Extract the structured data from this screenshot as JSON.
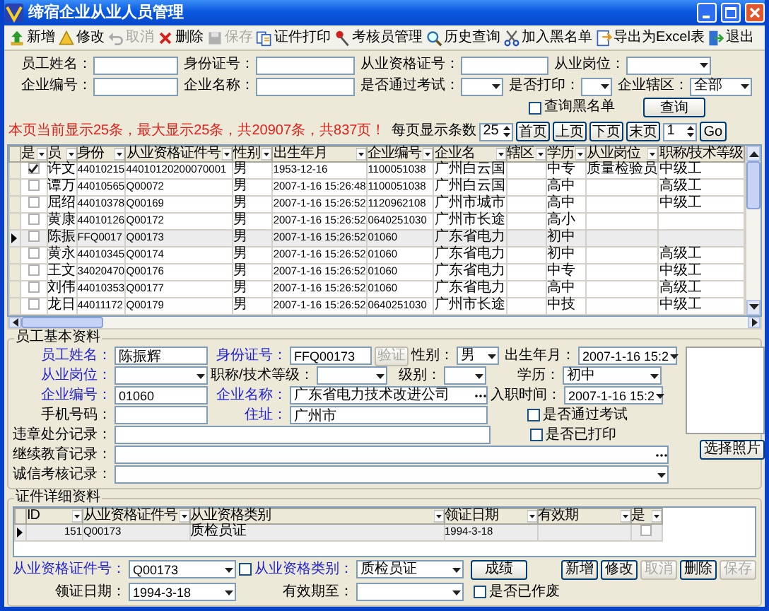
{
  "window": {
    "title": "缔宿企业从业人员管理"
  },
  "toolbar": [
    {
      "label": "新增",
      "kind": "add",
      "disabled": false
    },
    {
      "label": "修改",
      "kind": "edit",
      "disabled": false
    },
    {
      "label": "取消",
      "kind": "cancel",
      "disabled": true
    },
    {
      "label": "删除",
      "kind": "delete",
      "disabled": false
    },
    {
      "label": "保存",
      "kind": "save",
      "disabled": true
    },
    {
      "label": "证件打印",
      "kind": "print",
      "disabled": false
    },
    {
      "label": "考核员管理",
      "kind": "examiner",
      "disabled": false
    },
    {
      "label": "历史查询",
      "kind": "history",
      "disabled": false
    },
    {
      "label": "加入黑名单",
      "kind": "blacklist",
      "disabled": false
    },
    {
      "label": "导出为Excel表",
      "kind": "export",
      "disabled": false
    },
    {
      "label": "退出",
      "kind": "exit",
      "disabled": false
    }
  ],
  "search": {
    "rows": [
      [
        {
          "label": "员工姓名：",
          "kind": "text"
        },
        {
          "label": "身份证号：",
          "kind": "text"
        },
        {
          "label": "从业资格证号：",
          "kind": "text"
        },
        {
          "label": "从业岗位：",
          "kind": "select"
        }
      ],
      [
        {
          "label": "企业编号：",
          "kind": "text"
        },
        {
          "label": "企业名称：",
          "kind": "text"
        },
        {
          "label": "是否通过考试：",
          "kind": "select"
        },
        {
          "label": "是否打印：",
          "kind": "select"
        },
        {
          "label": "企业辖区：",
          "kind": "select",
          "value": "全部"
        }
      ]
    ],
    "blacklist": {
      "label": "查询黑名单",
      "checked": false
    },
    "query_button": "查询"
  },
  "paging": {
    "summary": "本页当前显示25条，最大显示25条，共20907条，共837页！",
    "page_size_label": "每页显示条数",
    "page_size": "25",
    "buttons": [
      "首页",
      "上页",
      "下页",
      "末页"
    ],
    "page": "1",
    "go": "Go"
  },
  "grid": {
    "check_column": "是",
    "columns": [
      "员",
      "身份",
      "从业资格证件号",
      "性别",
      "出生年月",
      "企业编号",
      "企业名",
      "辖区",
      "学历",
      "从业岗位",
      "职称/技术等级"
    ],
    "rows": [
      {
        "selected": false,
        "checked": true,
        "cells": [
          "许文",
          "44010215",
          "44010120200070001",
          "男",
          "1953-12-16",
          "1100051038",
          "广州白云国",
          null,
          "中专",
          "质量检验员",
          "中级工"
        ]
      },
      {
        "selected": false,
        "checked": false,
        "cells": [
          "谭万",
          "44010565",
          "Q00072",
          "男",
          "2007-1-16 15:26:48",
          "1100051038",
          "广州白云国",
          null,
          "高中",
          null,
          "高级工"
        ]
      },
      {
        "selected": false,
        "checked": false,
        "cells": [
          "屈绍",
          "44010378",
          "Q00169",
          "男",
          "2007-1-16 15:26:52",
          "1120962108",
          "广州市城市",
          null,
          "高中",
          null,
          "中级工"
        ]
      },
      {
        "selected": false,
        "checked": false,
        "cells": [
          "黄康",
          "44010126",
          "Q00172",
          "男",
          "2007-1-16 15:26:52",
          "0640251030",
          "广州市长途",
          null,
          "高小",
          null,
          null
        ]
      },
      {
        "selected": true,
        "checked": false,
        "cells": [
          "陈振",
          "FFQ0017",
          "Q00173",
          "男",
          "2007-1-16 15:26:52",
          "01060",
          "广东省电力",
          null,
          "初中",
          null,
          null
        ]
      },
      {
        "selected": false,
        "checked": false,
        "cells": [
          "黄永",
          "44010345",
          "Q00174",
          "男",
          "2007-1-16 15:26:52",
          "01060",
          "广东省电力",
          null,
          "初中",
          null,
          "高级工"
        ]
      },
      {
        "selected": false,
        "checked": false,
        "cells": [
          "王文",
          "34020470",
          "Q00176",
          "男",
          "2007-1-16 15:26:52",
          "01060",
          "广东省电力",
          null,
          "中专",
          null,
          "中级工"
        ]
      },
      {
        "selected": false,
        "checked": false,
        "cells": [
          "刘伟",
          "44010353",
          "Q00177",
          "男",
          "2007-1-16 15:26:52",
          "01060",
          "广东省电力",
          null,
          "高中",
          null,
          "高级工"
        ]
      },
      {
        "selected": false,
        "checked": false,
        "cells": [
          "龙日",
          "44011172",
          "Q00179",
          "男",
          "2007-1-16 15:26:52",
          "0640251030",
          "广州市长途",
          null,
          "中技",
          null,
          "中级工"
        ]
      }
    ]
  },
  "employee": {
    "legend": "员工基本资料",
    "name": {
      "label": "员工姓名：",
      "required": true,
      "value": "陈振辉"
    },
    "id_number": {
      "label": "身份证号：",
      "required": true,
      "value": "FFQ00173"
    },
    "verify_button": {
      "label": "验证",
      "disabled": true
    },
    "gender": {
      "label": "性别：",
      "required": false,
      "value": "男"
    },
    "birth": {
      "label": "出生年月：",
      "required": false,
      "value": "2007-1-16 15:2"
    },
    "post": {
      "label": "从业岗位：",
      "required": true
    },
    "title_level": {
      "label": "职称/技术等级：",
      "required": false
    },
    "grade": {
      "label": "级别：",
      "required": false
    },
    "education": {
      "label": "学历：",
      "required": false,
      "value": "初中"
    },
    "company_code": {
      "label": "企业编号：",
      "required": true,
      "value": "01060"
    },
    "company_name": {
      "label": "企业名称：",
      "required": true,
      "value": "广东省电力技术改进公司"
    },
    "hire_date": {
      "label": "入职时间：",
      "required": false,
      "value": "2007-1-16 15:2"
    },
    "mobile": {
      "label": "手机号码：",
      "required": false
    },
    "address": {
      "label": "住址：",
      "required": true,
      "value": "广州市"
    },
    "passed_exam": {
      "label": "是否通过考试",
      "checked": false
    },
    "violations": {
      "label": "违章处分记录：",
      "required": false
    },
    "printed": {
      "label": "是否已打印",
      "checked": false
    },
    "education_record": {
      "label": "继续教育记录：",
      "required": false
    },
    "integrity_record": {
      "label": "诚信考核记录：",
      "required": false
    },
    "photo_button": "选择照片"
  },
  "certificates": {
    "legend": "证件详细资料",
    "columns": [
      "ID",
      "从业资格证件号",
      "从业资格类别",
      "领证日期",
      "有效期",
      "是"
    ],
    "rows": [
      {
        "selected": true,
        "id": "151",
        "cert_no": "Q00173",
        "category": "质检员证",
        "issue_date": "1994-3-18",
        "checked": false
      }
    ],
    "buttons": [
      {
        "label": "新增",
        "disabled": false
      },
      {
        "label": "修改",
        "disabled": false
      },
      {
        "label": "取消",
        "disabled": true
      },
      {
        "label": "删除",
        "disabled": false
      },
      {
        "label": "保存",
        "disabled": true
      }
    ],
    "cert_no": {
      "label": "从业资格证件号：",
      "required": true,
      "value": "Q00173"
    },
    "category_checkbox": {
      "checked": false
    },
    "category": {
      "label": "从业资格类别：",
      "required": true,
      "value": "质检员证"
    },
    "score_button": "成绩",
    "issue_date": {
      "label": "领证日期：",
      "required": false,
      "value": "1994-3-18"
    },
    "expiry": {
      "label": "有效期至：",
      "required": false
    },
    "void": {
      "label": "是否已作废",
      "checked": false
    }
  }
}
